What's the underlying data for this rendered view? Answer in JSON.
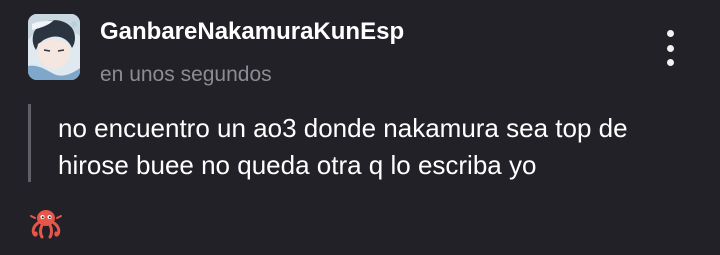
{
  "post": {
    "username": "GanbareNakamuraKunEsp",
    "timestamp": "en unos segundos",
    "body": "no encuentro un ao3 donde nakamura sea top de\nhirose buee no queda otra q lo escriba yo",
    "avatar_icon": "user-avatar",
    "menu_icon": "more-vertical-icon",
    "reaction_icon": "octopus-icon"
  },
  "colors": {
    "background": "#212127",
    "username": "#ffffff",
    "timestamp": "#8c8c93",
    "quote_bar": "#5f5f68",
    "reaction": "#e8564a"
  }
}
